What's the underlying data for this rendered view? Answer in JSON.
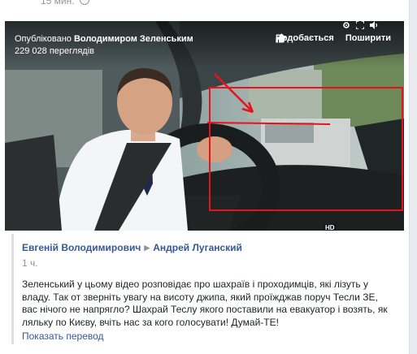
{
  "post": {
    "time_text": "15 мин.",
    "privacy_icon": "globe-icon"
  },
  "video": {
    "published_prefix": "Опубліковано",
    "published_author": "Володимиром Зеленським",
    "views": "229 028 переглядів",
    "like_label": "Подобається",
    "share_label": "Поширити",
    "hd_label": "HD",
    "highlight_color": "#e8121b"
  },
  "shared": {
    "author": "Евгеній Володимирович",
    "target": "Андрей Луганский",
    "time": "1 ч.",
    "message": "Зеленський у цьому відео розповідає про шахраїв і проходимців, які лізуть у владу. Так от зверніть увагу на висоту джипа, який проїжджав поруч Тесли ЗЕ, вас нічого не напрягло? Шахрай Теслу якого поставили на евакуатор і возять, як ляльку по Києву, вчіть нас за кого голосувати! Думай-ТЕ!",
    "translate_label": "Показать перевод"
  }
}
